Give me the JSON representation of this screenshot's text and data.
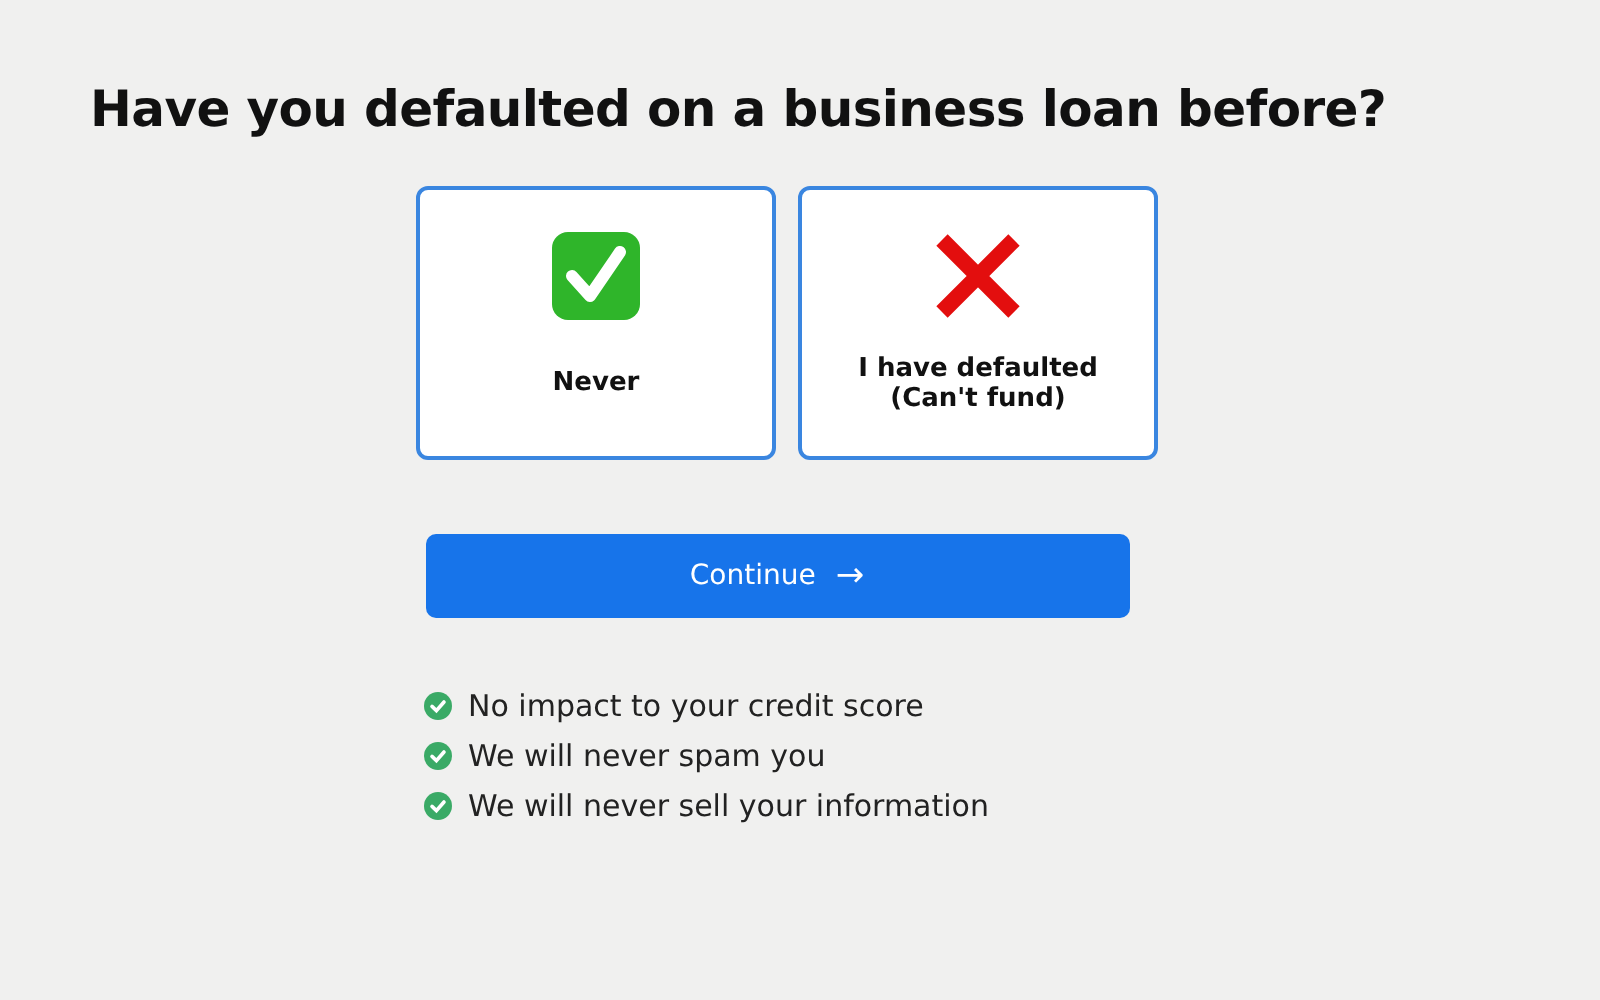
{
  "question": "Have you defaulted on a business loan before?",
  "options": [
    {
      "kind": "check",
      "label": "Never"
    },
    {
      "kind": "cross",
      "label": "I have defaulted\n(Can't fund)"
    }
  ],
  "continue_button": {
    "label": "Continue",
    "arrow": "→"
  },
  "assurances": [
    "No impact to your credit score",
    "We will never spam you",
    "We will never sell your information"
  ]
}
